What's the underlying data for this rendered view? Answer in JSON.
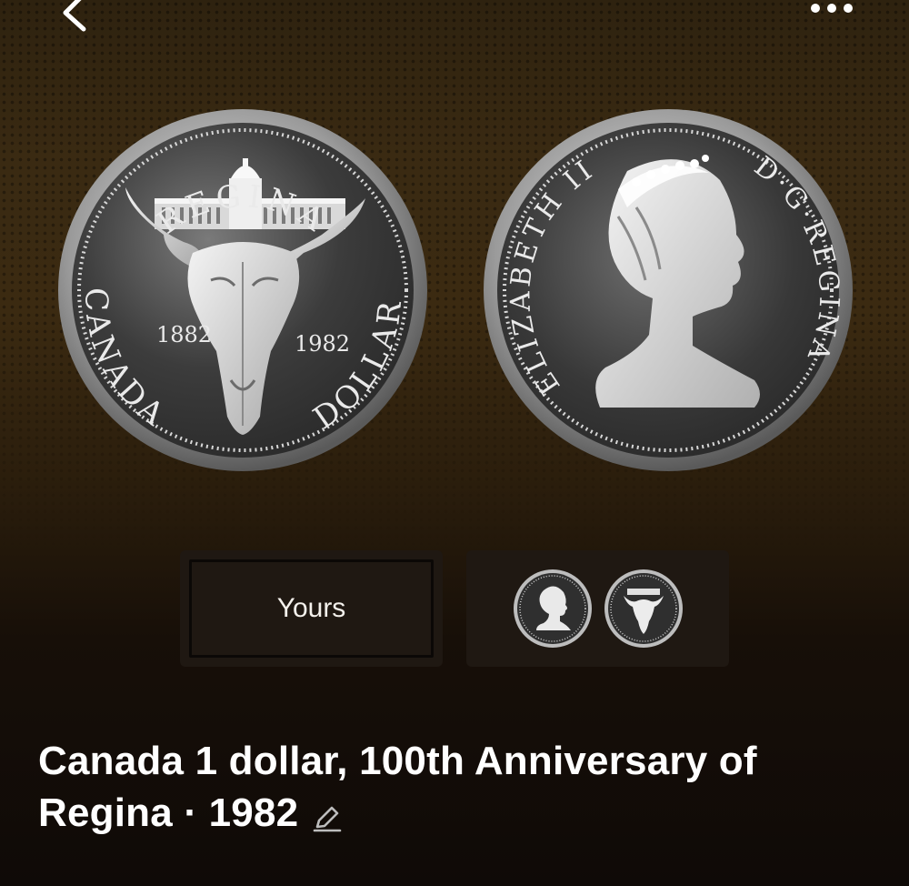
{
  "nav": {
    "back_icon": "chevron-left-icon",
    "more_icon": "more-dots-icon"
  },
  "coins": {
    "reverse": {
      "top_legend": "REGINA",
      "left_legend": "CANADA",
      "right_legend": "DOLLAR",
      "year_left": "1882",
      "year_right": "1982"
    },
    "obverse": {
      "left_legend": "ELIZABETH II",
      "right_legend": "D·G·REGINA"
    }
  },
  "tabs": {
    "yours_label": "Yours"
  },
  "coin_title": {
    "name": "Canada 1 dollar, 100th Anniversary of Regina",
    "separator": " · ",
    "year": "1982",
    "edit_icon": "pencil-icon"
  },
  "colors": {
    "background_top": "#3a2a12",
    "background_bottom": "#0f0a07",
    "tab_background": "#1f1812",
    "text": "#ffffff"
  }
}
